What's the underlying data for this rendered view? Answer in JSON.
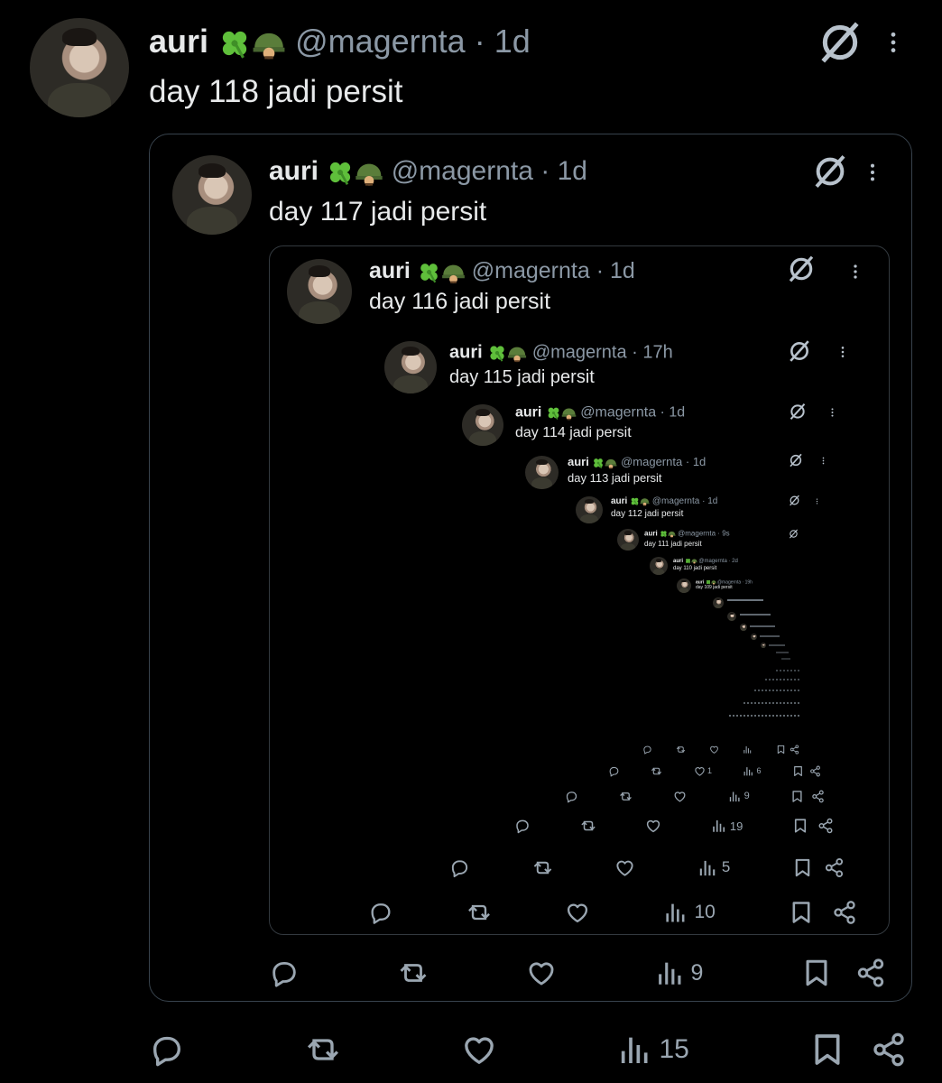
{
  "tweets": [
    {
      "name": "auri",
      "handle": "@magernta",
      "dot": "·",
      "time": "1d",
      "text": "day 118 jadi persit",
      "views": "15"
    },
    {
      "name": "auri",
      "handle": "@magernta",
      "dot": "·",
      "time": "1d",
      "text": "day 117 jadi persit",
      "views": "9"
    },
    {
      "name": "auri",
      "handle": "@magernta",
      "dot": "·",
      "time": "1d",
      "text": "day 116 jadi persit",
      "views": "10"
    },
    {
      "name": "auri",
      "handle": "@magernta",
      "dot": "·",
      "time": "17h",
      "text": "day 115 jadi persit",
      "views": "5"
    },
    {
      "name": "auri",
      "handle": "@magernta",
      "dot": "·",
      "time": "1d",
      "text": "day 114 jadi persit",
      "views": "19"
    },
    {
      "name": "auri",
      "handle": "@magernta",
      "dot": "·",
      "time": "1d",
      "text": "day 113 jadi persit",
      "views": "9"
    },
    {
      "name": "auri",
      "handle": "@magernta",
      "dot": "·",
      "time": "1d",
      "text": "day 112 jadi persit",
      "views": "6"
    },
    {
      "name": "auri",
      "handle": "@magernta",
      "dot": "·",
      "time": "9s",
      "text": "day 111 jadi persit"
    },
    {
      "name": "auri",
      "handle": "@magernta",
      "dot": "·",
      "time": "2d",
      "text": "day 110 jadi persit"
    },
    {
      "name": "auri",
      "handle": "@magernta",
      "dot": "·",
      "time": "19h",
      "text": "day 109 jadi persit"
    }
  ],
  "deep_reply_count": "1",
  "icons": {
    "grok": "slashed-circle-icon",
    "more": "more-vertical-icon",
    "reply": "reply-icon",
    "retweet": "retweet-icon",
    "like": "heart-icon",
    "views": "views-icon",
    "bookmark": "bookmark-icon",
    "share": "share-icon",
    "emoji1": "four-leaf-clover-icon",
    "emoji2": "military-helmet-icon"
  },
  "colors": {
    "background": "#000000",
    "text": "#e7e9ea",
    "muted": "#8b98a5",
    "border": "#38434d"
  }
}
